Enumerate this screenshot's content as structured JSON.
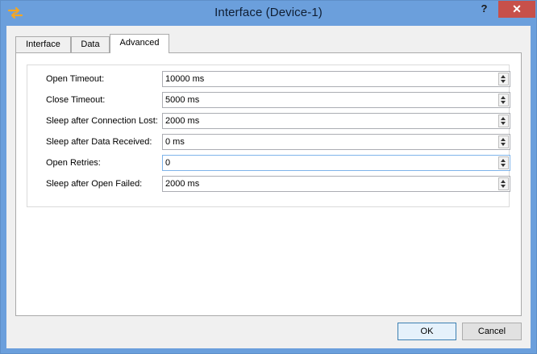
{
  "window": {
    "title": "Interface (Device-1)",
    "help_label": "?",
    "close_label": "✕",
    "app_icon": "arrows-swap-icon"
  },
  "tabs": [
    {
      "label": "Interface",
      "active": false
    },
    {
      "label": "Data",
      "active": false
    },
    {
      "label": "Advanced",
      "active": true
    }
  ],
  "settings": [
    {
      "label": "Open Timeout:",
      "value": "10000 ms"
    },
    {
      "label": "Close Timeout:",
      "value": "5000 ms"
    },
    {
      "label": "Sleep after Connection Lost:",
      "value": "2000 ms"
    },
    {
      "label": "Sleep after Data Received:",
      "value": "0 ms"
    },
    {
      "label": "Open Retries:",
      "value": "0"
    },
    {
      "label": "Sleep after Open Failed:",
      "value": "2000 ms"
    }
  ],
  "buttons": {
    "ok_label": "OK",
    "cancel_label": "Cancel"
  },
  "colors": {
    "titlebar": "#6b9fdc",
    "close_button": "#c7504a",
    "icon_orange": "#f5a623"
  }
}
